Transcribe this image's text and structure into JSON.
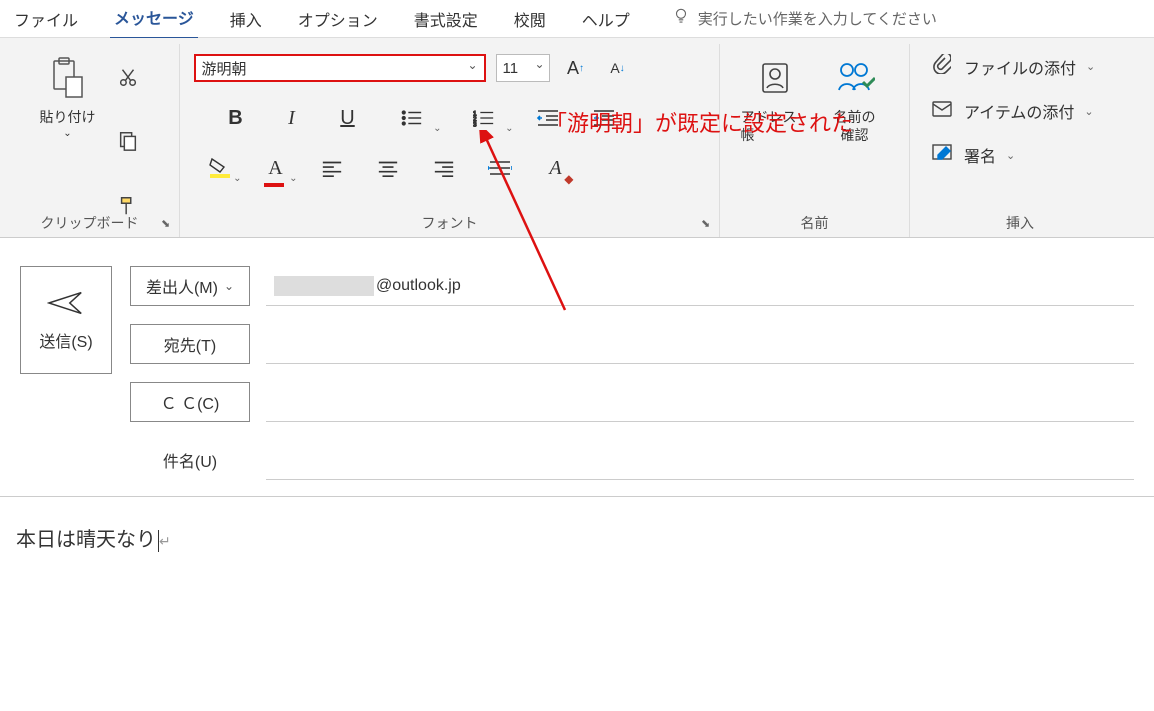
{
  "tabs": {
    "file": "ファイル",
    "message": "メッセージ",
    "insert": "挿入",
    "options": "オプション",
    "format": "書式設定",
    "review": "校閲",
    "help": "ヘルプ",
    "tellme": "実行したい作業を入力してください"
  },
  "ribbon": {
    "groups": {
      "clipboard": "クリップボード",
      "font": "フォント",
      "names": "名前",
      "insert": "挿入"
    },
    "paste": "貼り付け",
    "font_name": "游明朝",
    "font_size": "11",
    "address_book": "アドレス帳",
    "check_names": "名前の\n確認",
    "attach_file": "ファイルの添付",
    "attach_item": "アイテムの添付",
    "signature": "署名"
  },
  "annotation": "「游明朝」が既定に設定された",
  "compose": {
    "send": "送信(S)",
    "from_btn": "差出人(M)",
    "from_value_domain": "@outlook.jp",
    "to_btn": "宛先(T)",
    "cc_btn": "Ｃ Ｃ(C)",
    "subject_label": "件名(U)",
    "body": "本日は晴天なり"
  }
}
